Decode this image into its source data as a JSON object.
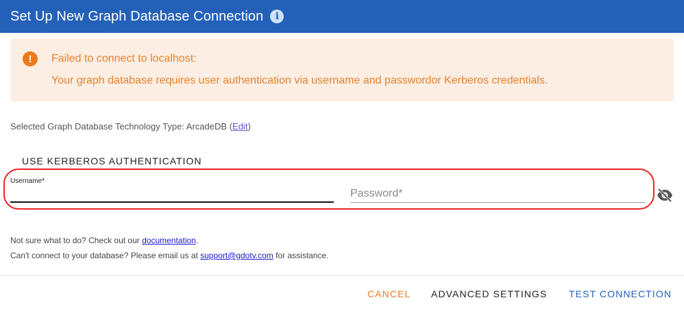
{
  "header": {
    "title": "Set Up New Graph Database Connection",
    "info_icon": "info-icon",
    "background": "#2361b9"
  },
  "alert": {
    "icon": "alert-exclamation-icon",
    "title": "Failed to connect to localhost:",
    "message": "Your graph database requires user authentication via username and passwordor Kerberos credentials.",
    "color": "#e6812c",
    "background": "#fdeee3"
  },
  "technology": {
    "prefix": "Selected Graph Database Technology Type: ArcadeDB",
    "open_paren": "(",
    "edit_link": "Edit",
    "close_paren": ")"
  },
  "auth": {
    "kerberos_button": "USE KERBEROS AUTHENTICATION",
    "username_label": "Username*",
    "username_value": "",
    "password_placeholder": "Password*",
    "visibility_icon": "eye-off-icon"
  },
  "help": {
    "line1_prefix": "Not sure what to do? Check out our ",
    "line1_link": "documentation",
    "line1_suffix": ".",
    "line2_prefix": "Can't connect to your database? Please email us at ",
    "line2_link": "support@gdotv.com",
    "line2_suffix": " for assistance."
  },
  "footer": {
    "cancel": "CANCEL",
    "advanced": "ADVANCED SETTINGS",
    "test": "TEST CONNECTION"
  }
}
